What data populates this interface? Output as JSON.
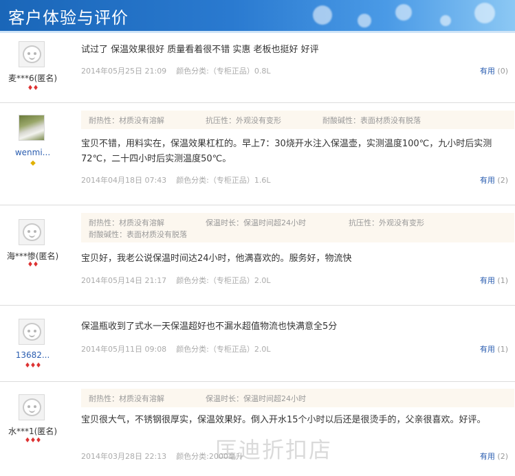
{
  "header": {
    "title": "客户体验与评价"
  },
  "reviews": [
    {
      "user": "麦***6(匿名)",
      "rank": "♦♦",
      "avatar": "default-avatar",
      "content": "试过了 保温效果很好 质量看着很不错 实惠 老板也挺好 好评",
      "date": "2014年05月25日 21:09",
      "variant": "颜色分类:（专柜正品）0.8L",
      "useful_label": "有用",
      "useful_count": "(0)"
    },
    {
      "user": "wenmi...",
      "rank": "◆",
      "avatar": "tiger-photo",
      "attrs": [
        "耐热性：材质没有溶解",
        "抗压性：外观没有变形",
        "耐酸碱性：表面材质没有脱落"
      ],
      "content": "宝贝不错，用料实在，保温效果杠杠的。早上7：30烧开水注入保温壶，实测温度100℃，九小时后实测72℃，二十四小时后实测温度50℃。",
      "date": "2014年04月18日 07:43",
      "variant": "颜色分类:（专柜正品）1.6L",
      "useful_label": "有用",
      "useful_count": "(2)"
    },
    {
      "user": "海***惨(匿名)",
      "rank": "♦♦",
      "avatar": "default-avatar",
      "attrs": [
        "耐热性：材质没有溶解",
        "保温时长：保温时间超24小时",
        "抗压性：外观没有变形",
        "耐酸碱性：表面材质没有脱落"
      ],
      "content": "宝贝好，我老公说保温时间达24小时，他满喜欢的。服务好，物流快",
      "date": "2014年05月14日 21:17",
      "variant": "颜色分类:（专柜正品）2.0L",
      "useful_label": "有用",
      "useful_count": "(1)"
    },
    {
      "user": "13682...",
      "rank": "♦♦♦",
      "avatar": "default-avatar",
      "content": "保温瓶收到了式水一天保温超好也不漏水超值物流也快满意全5分",
      "date": "2014年05月11日 09:08",
      "variant": "颜色分类:（专柜正品）2.0L",
      "useful_label": "有用",
      "useful_count": "(1)"
    },
    {
      "user": "水***1(匿名)",
      "rank": "♦♦♦",
      "avatar": "default-avatar",
      "attrs": [
        "耐热性：材质没有溶解",
        "保温时长：保温时间超24小时"
      ],
      "content": "宝贝很大气，不锈钢很厚实，保温效果好。倒入开水15个小时以后还是很烫手的，父亲很喜欢。好评。",
      "date": "2014年03月28日 22:13",
      "variant": "颜色分类:2000毫升",
      "useful_label": "有用",
      "useful_count": "(2)"
    }
  ],
  "watermark": "匡迪折扣店"
}
